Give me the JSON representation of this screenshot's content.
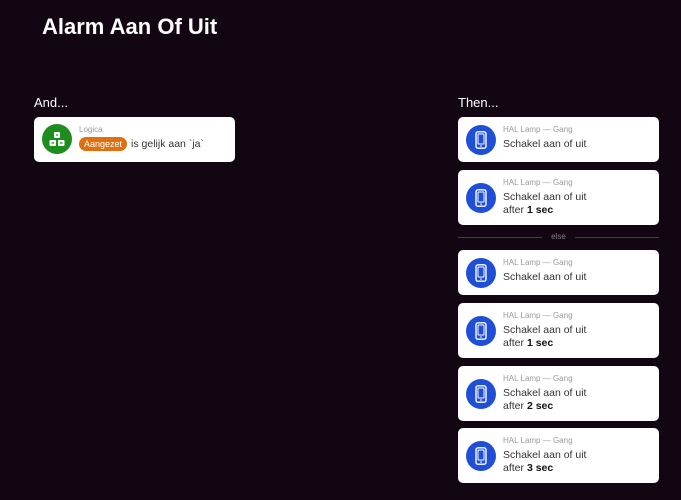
{
  "page": {
    "title": "Alarm Aan Of Uit"
  },
  "and_column": {
    "header": "And...",
    "conditions": [
      {
        "category": "Logica",
        "tag": "Aangezet",
        "text": "is gelijk aan `ja`"
      }
    ]
  },
  "then_column": {
    "header": "Then...",
    "else_label": "else",
    "actions": [
      {
        "device": "HAL Lamp — Gang",
        "action": "Schakel aan of uit",
        "after_prefix": "",
        "delay": ""
      },
      {
        "device": "HAL Lamp — Gang",
        "action": "Schakel aan of uit",
        "after_prefix": "after",
        "delay": "1 sec"
      }
    ],
    "else_actions": [
      {
        "device": "HAL Lamp — Gang",
        "action": "Schakel aan of uit",
        "after_prefix": "",
        "delay": ""
      },
      {
        "device": "HAL Lamp — Gang",
        "action": "Schakel aan of uit",
        "after_prefix": "after",
        "delay": "1 sec"
      },
      {
        "device": "HAL Lamp — Gang",
        "action": "Schakel aan of uit",
        "after_prefix": "after",
        "delay": "2 sec"
      },
      {
        "device": "HAL Lamp — Gang",
        "action": "Schakel aan of uit",
        "after_prefix": "after",
        "delay": "3 sec"
      }
    ]
  },
  "colors": {
    "background": "#120612",
    "logic_icon": "#1e8c1e",
    "device_icon": "#1f4fd6",
    "tag": "#e0700f"
  },
  "icons": {
    "logic": "logic-icon",
    "device": "phone-icon"
  }
}
